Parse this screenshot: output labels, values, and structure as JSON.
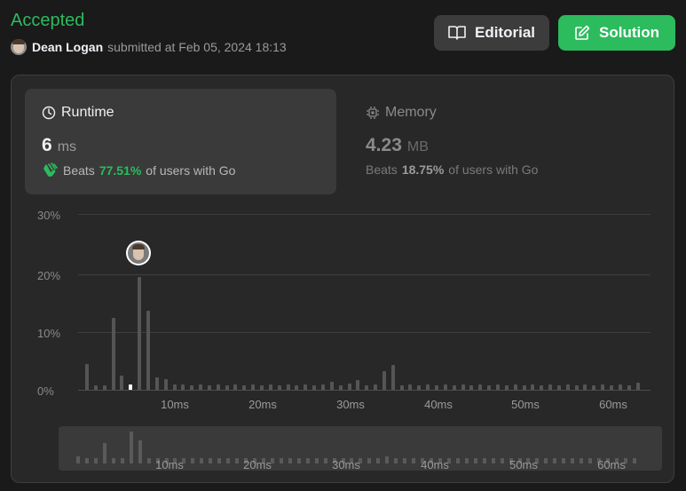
{
  "status": "Accepted",
  "submission": {
    "username": "Dean Logan",
    "text": "submitted at Feb 05, 2024 18:13"
  },
  "buttons": {
    "editorial": "Editorial",
    "solution": "Solution"
  },
  "runtime": {
    "title": "Runtime",
    "value": "6",
    "unit": "ms",
    "beats_label": "Beats",
    "beats_pct": "77.51%",
    "beats_suffix": "of users with Go"
  },
  "memory": {
    "title": "Memory",
    "value": "4.23",
    "unit": "MB",
    "beats_label": "Beats",
    "beats_pct": "18.75%",
    "beats_suffix": "of users with Go"
  },
  "chart_data": {
    "type": "bar",
    "ylim": [
      0,
      30
    ],
    "yticks": [
      "30%",
      "20%",
      "10%",
      "0%"
    ],
    "xticks": [
      "10ms",
      "20ms",
      "30ms",
      "40ms",
      "50ms",
      "60ms"
    ],
    "xtick_values": [
      10,
      20,
      30,
      40,
      50,
      60
    ],
    "x": [
      1,
      2,
      3,
      4,
      5,
      6,
      7,
      8,
      9,
      10,
      11,
      12,
      13,
      14,
      15,
      16,
      17,
      18,
      19,
      20,
      21,
      22,
      23,
      24,
      25,
      26,
      27,
      28,
      29,
      30,
      31,
      32,
      33,
      34,
      35,
      36,
      37,
      38,
      39,
      40,
      41,
      42,
      43,
      44,
      45,
      46,
      47,
      48,
      49,
      50,
      51,
      52,
      53,
      54,
      55,
      56,
      57,
      58,
      59,
      60,
      61,
      62,
      63,
      64
    ],
    "values": [
      4.4,
      0.8,
      0.8,
      12.3,
      2.4,
      0.9,
      19.2,
      13.5,
      2.1,
      1.8,
      0.9,
      0.9,
      0.8,
      0.9,
      0.8,
      0.9,
      0.8,
      0.9,
      0.8,
      0.9,
      0.8,
      0.9,
      0.8,
      0.9,
      0.8,
      0.9,
      0.8,
      0.9,
      1.4,
      0.8,
      1.0,
      1.7,
      0.8,
      0.9,
      3.2,
      4.3,
      0.8,
      0.9,
      0.8,
      0.9,
      0.8,
      0.9,
      0.8,
      0.9,
      0.8,
      0.9,
      0.8,
      0.9,
      0.8,
      0.9,
      0.8,
      0.9,
      0.8,
      0.9,
      0.8,
      0.9,
      0.8,
      0.9,
      0.8,
      0.9,
      0.8,
      0.9,
      0.8,
      1.2
    ],
    "highlight_x": 6,
    "grid": true
  }
}
